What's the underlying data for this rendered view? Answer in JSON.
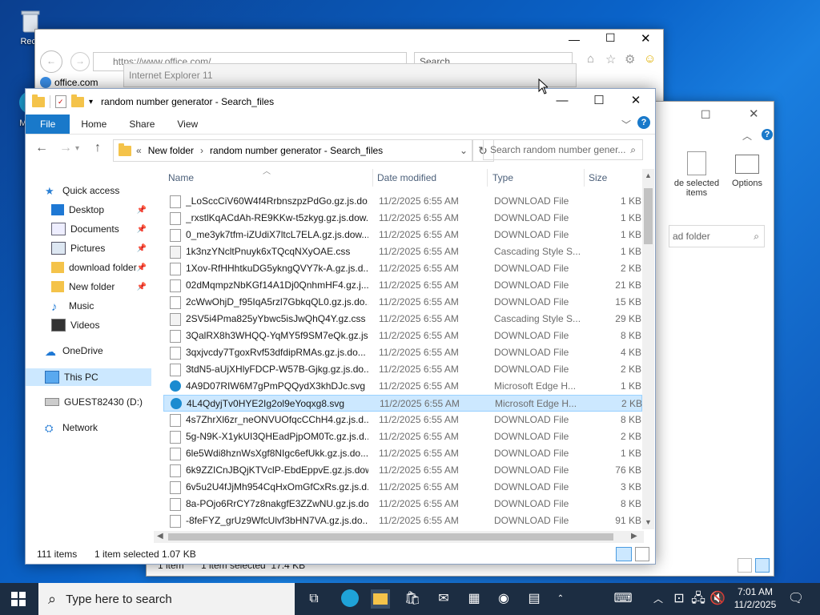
{
  "desktop": {
    "icons": [
      {
        "label": "Recy",
        "icon": "recycle-bin-icon"
      },
      {
        "label": "Mic E",
        "icon": "edge-icon"
      }
    ]
  },
  "ie_window": {
    "url": "https://www.office.com/",
    "tab_label": "office.com",
    "search_placeholder": "Search",
    "tooltip": "Internet Explorer 11"
  },
  "bg_explorer": {
    "ribbon_label": "de selected items",
    "options_label": "Options",
    "search_text": "ad folder",
    "status_count": "1 item",
    "status_selected": "1 item selected  17.4 KB"
  },
  "explorer": {
    "title": "random number generator - Search_files",
    "ribbon_tabs": [
      "File",
      "Home",
      "Share",
      "View"
    ],
    "breadcrumb": [
      "New folder",
      "random number generator - Search_files"
    ],
    "search_placeholder": "Search random number gener...",
    "columns": {
      "name": "Name",
      "date": "Date modified",
      "type": "Type",
      "size": "Size"
    },
    "nav": [
      {
        "label": "Quick access",
        "icon": "star-icon",
        "pinned": false
      },
      {
        "label": "Desktop",
        "icon": "desktop-icon",
        "pinned": true
      },
      {
        "label": "Documents",
        "icon": "documents-icon",
        "pinned": true
      },
      {
        "label": "Pictures",
        "icon": "pictures-icon",
        "pinned": true
      },
      {
        "label": "download folder",
        "icon": "folder-icon",
        "pinned": true
      },
      {
        "label": "New folder",
        "icon": "folder-icon",
        "pinned": true
      },
      {
        "label": "Music",
        "icon": "music-icon",
        "pinned": false
      },
      {
        "label": "Videos",
        "icon": "videos-icon",
        "pinned": false
      },
      {
        "label": "OneDrive",
        "icon": "cloud-icon",
        "pinned": false
      },
      {
        "label": "This PC",
        "icon": "pc-icon",
        "pinned": false
      },
      {
        "label": "GUEST82430 (D:)",
        "icon": "drive-icon",
        "pinned": false
      },
      {
        "label": "Network",
        "icon": "network-icon",
        "pinned": false
      }
    ],
    "files": [
      {
        "name": "_LoSccCiV60W4f4RrbnszpzPdGo.gz.js.do...",
        "date": "11/2/2025 6:55 AM",
        "type": "DOWNLOAD File",
        "size": "1 KB",
        "icon": "file-icon"
      },
      {
        "name": "_rxstlKqACdAh-RE9KKw-t5zkyg.gz.js.dow...",
        "date": "11/2/2025 6:55 AM",
        "type": "DOWNLOAD File",
        "size": "1 KB",
        "icon": "file-icon"
      },
      {
        "name": "0_me3yk7tfm-iZUdiX7ltcL7ELA.gz.js.dow...",
        "date": "11/2/2025 6:55 AM",
        "type": "DOWNLOAD File",
        "size": "1 KB",
        "icon": "file-icon"
      },
      {
        "name": "1k3nzYNcltPnuyk6xTQcqNXyOAE.css",
        "date": "11/2/2025 6:55 AM",
        "type": "Cascading Style S...",
        "size": "1 KB",
        "icon": "css-file-icon"
      },
      {
        "name": "1Xov-RfHHhtkuDG5ykngQVY7k-A.gz.js.d...",
        "date": "11/2/2025 6:55 AM",
        "type": "DOWNLOAD File",
        "size": "2 KB",
        "icon": "file-icon"
      },
      {
        "name": "02dMqmpzNbKGf14A1Dj0QnhmHF4.gz.j...",
        "date": "11/2/2025 6:55 AM",
        "type": "DOWNLOAD File",
        "size": "21 KB",
        "icon": "file-icon"
      },
      {
        "name": "2cWwOhjD_f95IqA5rzl7GbkqQL0.gz.js.do...",
        "date": "11/2/2025 6:55 AM",
        "type": "DOWNLOAD File",
        "size": "15 KB",
        "icon": "file-icon"
      },
      {
        "name": "2SV5i4Pma825yYbwc5isJwQhQ4Y.gz.css",
        "date": "11/2/2025 6:55 AM",
        "type": "Cascading Style S...",
        "size": "29 KB",
        "icon": "css-file-icon"
      },
      {
        "name": "3QalRX8h3WHQQ-YqMY5f9SM7eQk.gz.js...",
        "date": "11/2/2025 6:55 AM",
        "type": "DOWNLOAD File",
        "size": "8 KB",
        "icon": "file-icon"
      },
      {
        "name": "3qxjvcdy7TgoxRvf53dfdipRMAs.gz.js.do...",
        "date": "11/2/2025 6:55 AM",
        "type": "DOWNLOAD File",
        "size": "4 KB",
        "icon": "file-icon"
      },
      {
        "name": "3tdN5-aUjXHlyFDCP-W57B-Gjkg.gz.js.do...",
        "date": "11/2/2025 6:55 AM",
        "type": "DOWNLOAD File",
        "size": "2 KB",
        "icon": "file-icon"
      },
      {
        "name": "4A9D07RIW6M7gPmPQQydX3khDJc.svg",
        "date": "11/2/2025 6:55 AM",
        "type": "Microsoft Edge H...",
        "size": "1 KB",
        "icon": "edge-file-icon"
      },
      {
        "name": "4L4QdyjTv0HYE2Ig2ol9eYoqxg8.svg",
        "date": "11/2/2025 6:55 AM",
        "type": "Microsoft Edge H...",
        "size": "2 KB",
        "icon": "edge-file-icon",
        "selected": true
      },
      {
        "name": "4s7ZhrXl6zr_neONVUOfqcCChH4.gz.js.d...",
        "date": "11/2/2025 6:55 AM",
        "type": "DOWNLOAD File",
        "size": "8 KB",
        "icon": "file-icon"
      },
      {
        "name": "5g-N9K-X1ykUI3QHEadPjpOM0Tc.gz.js.d...",
        "date": "11/2/2025 6:55 AM",
        "type": "DOWNLOAD File",
        "size": "2 KB",
        "icon": "file-icon"
      },
      {
        "name": "6le5Wdi8hznWsXgf8NIgc6efUkk.gz.js.do...",
        "date": "11/2/2025 6:55 AM",
        "type": "DOWNLOAD File",
        "size": "1 KB",
        "icon": "file-icon"
      },
      {
        "name": "6k9ZZICnJBQjKTVclP-EbdEppvE.gz.js.dow...",
        "date": "11/2/2025 6:55 AM",
        "type": "DOWNLOAD File",
        "size": "76 KB",
        "icon": "file-icon"
      },
      {
        "name": "6v5u2U4fJjMh954CqHxOmGfCxRs.gz.js.d...",
        "date": "11/2/2025 6:55 AM",
        "type": "DOWNLOAD File",
        "size": "3 KB",
        "icon": "file-icon"
      },
      {
        "name": "8a-POjo6RrCY7z8nakgfE3ZZwNU.gz.js.do...",
        "date": "11/2/2025 6:55 AM",
        "type": "DOWNLOAD File",
        "size": "8 KB",
        "icon": "file-icon"
      },
      {
        "name": "-8feFYZ_grUz9WfcUlvf3bHN7VA.gz.js.do...",
        "date": "11/2/2025 6:55 AM",
        "type": "DOWNLOAD File",
        "size": "91 KB",
        "icon": "file-icon"
      }
    ],
    "status": {
      "count": "111 items",
      "selected": "1 item selected",
      "size": "1.07 KB"
    }
  },
  "taskbar": {
    "search_placeholder": "Type here to search",
    "time": "7:01 AM",
    "date": "11/2/2025"
  },
  "colors": {
    "accent": "#1979ca",
    "selection": "#cce8ff",
    "taskbar": "#1c2d42"
  }
}
